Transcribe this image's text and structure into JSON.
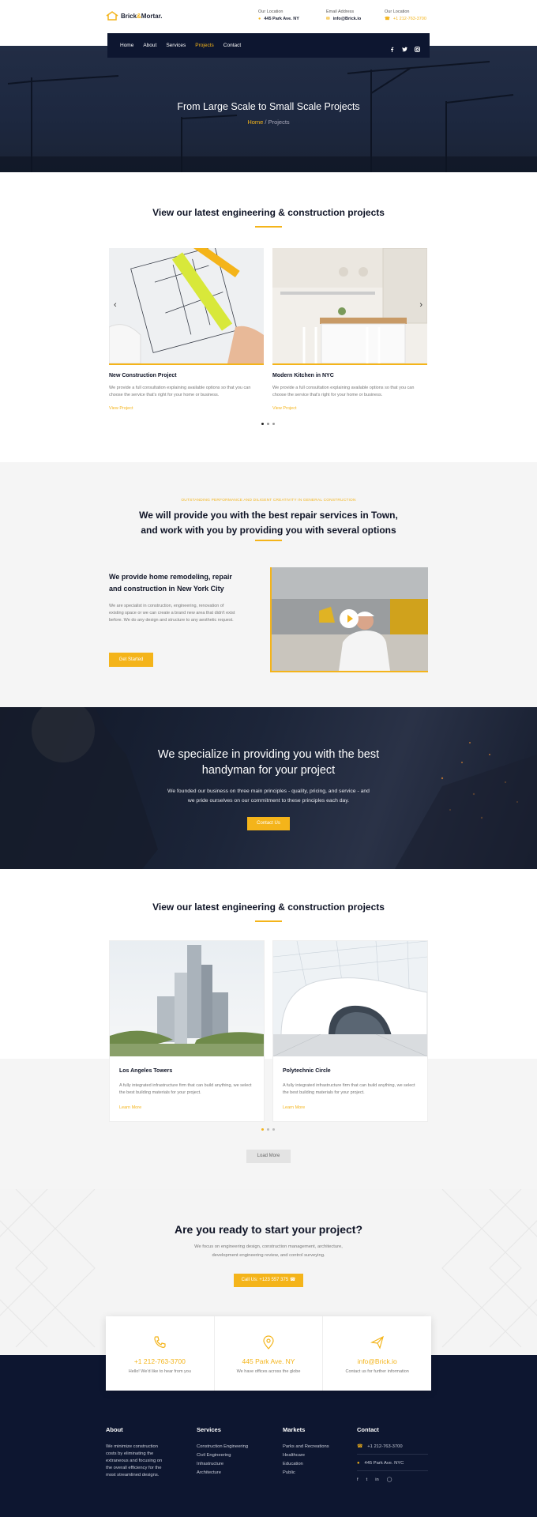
{
  "header": {
    "logo": {
      "part1": "Brick",
      "amp": "&",
      "part2": "Mortar."
    },
    "location": {
      "label": "Our Location",
      "value": "445 Park Ave. NY"
    },
    "email": {
      "label": "Email Address",
      "value": "info@Brick.io"
    },
    "phone": {
      "label": "Our Location",
      "value": "+1 212-763-3700"
    }
  },
  "nav": {
    "items": [
      {
        "label": "Home"
      },
      {
        "label": "About"
      },
      {
        "label": "Services"
      },
      {
        "label": "Projects"
      },
      {
        "label": "Contact"
      }
    ],
    "active": "Projects",
    "social": [
      "facebook-icon",
      "twitter-icon",
      "instagram-icon"
    ]
  },
  "hero": {
    "title": "From Large Scale to Small Scale Projects",
    "crumb_home": "Home",
    "crumb_sep": " / ",
    "crumb_current": "Projects"
  },
  "projects1": {
    "title": "View our latest engineering & construction projects",
    "cards": [
      {
        "title": "New Construction Project",
        "text": "We provide a full consultation explaining available options so that you can choose the service that's right for your home or business.",
        "link": "View Project"
      },
      {
        "title": "Modern Kitchen in NYC",
        "text": "We provide a full consultation explaining available options so that you can choose the service that's right for your home or business.",
        "link": "View Project"
      }
    ]
  },
  "services": {
    "eyebrow": "OUTSTANDING PERFORMANCE AND DILIGENT CREATIVITY IN GENERAL CONSTRUCTION",
    "title_line1": "We will provide you with the best repair services in Town,",
    "title_line2": "and work with you by providing you with several options",
    "sub_title_line1": "We provide home remodeling, repair",
    "sub_title_line2": "and construction in New York City",
    "text": "We are specialist in construction, engineering, renovation of existing space or we can create a brand new area that didn't exist before. We do any design and structure to any aesthetic request.",
    "button": "Get Started"
  },
  "specialize": {
    "title_line1": "We specialize in providing you with the best",
    "title_line2": "handyman for your project",
    "text_line1": "We founded our business on three main principles - quality, pricing, and service - and",
    "text_line2": "we pride ourselves on our commitment to these principles each day.",
    "button": "Contact Us"
  },
  "projects2": {
    "title": "View our latest engineering & construction projects",
    "cards": [
      {
        "title": "Los Angeles Towers",
        "text": "A fully integrated infrastructure firm that can build anything, we select the best building materials for your project.",
        "link": "Learn More"
      },
      {
        "title": "Polytechnic Circle",
        "text": "A fully integrated infrastructure firm that can build anything, we select the best building materials for your project.",
        "link": "Learn More"
      }
    ],
    "load_more": "Load More"
  },
  "cta": {
    "title": "Are you ready to start your project?",
    "text_line1": "We focus on engineering design, construction management, architecture,",
    "text_line2": "development engineering review, and control surveying.",
    "button": "Call Us: +123 557 375"
  },
  "contact_cards": [
    {
      "icon": "phone-icon",
      "value": "+1 212-763-3700",
      "sub": "Hello! We'd like to hear from you"
    },
    {
      "icon": "location-icon",
      "value": "445 Park Ave. NY",
      "sub": "We have offices across the globe"
    },
    {
      "icon": "send-icon",
      "value": "info@Brick.io",
      "sub": "Contact us for further information"
    }
  ],
  "footer": {
    "about": {
      "title": "About",
      "lines": [
        "We minimize construction",
        "costs by eliminating the",
        "extraneous and focusing on",
        "the overall efficiency for the",
        "most streamlined designs."
      ]
    },
    "services": {
      "title": "Services",
      "items": [
        "Construction Engineering",
        "Civil Engineering",
        "Infrastructure",
        "Architecture"
      ]
    },
    "markets": {
      "title": "Markets",
      "items": [
        "Parks and Recreations",
        "Healthcare",
        "Education",
        "Public"
      ]
    },
    "contact": {
      "title": "Contact",
      "phone": "+1 212-763-3700",
      "address": "445 Park Ave. NYC"
    }
  },
  "colors": {
    "accent": "#f4b41a",
    "navy": "#0d1630"
  }
}
